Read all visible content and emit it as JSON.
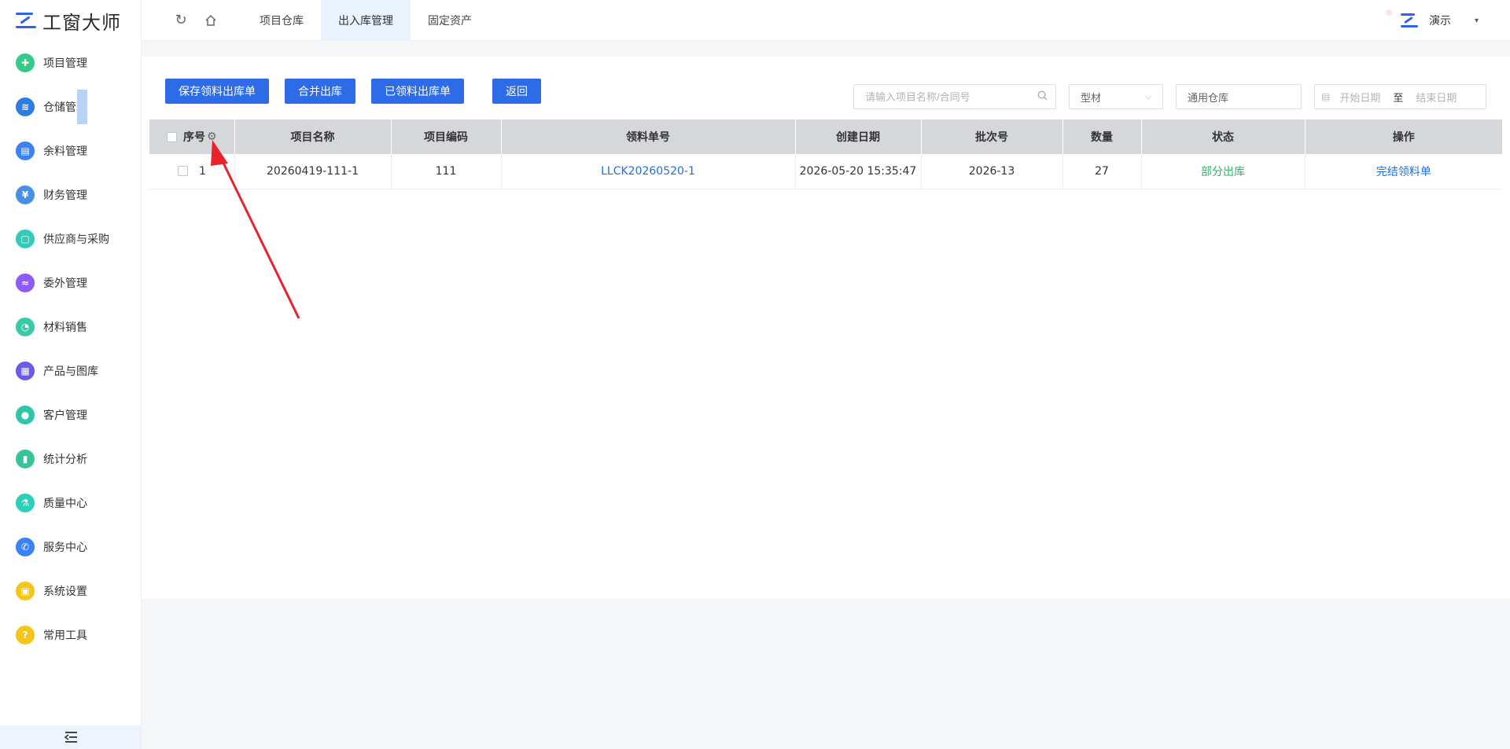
{
  "app": {
    "logo_text": "工窗大师"
  },
  "sidebar": {
    "items": [
      {
        "label": "项目管理",
        "color": "#35c98a",
        "glyph": "✚"
      },
      {
        "label": "仓储管理",
        "color": "#2f7de0",
        "glyph": "≋"
      },
      {
        "label": "余料管理",
        "color": "#3b82f6",
        "glyph": "▤"
      },
      {
        "label": "财务管理",
        "color": "#4a90e2",
        "glyph": "¥"
      },
      {
        "label": "供应商与采购",
        "color": "#35c9b7",
        "glyph": "▢"
      },
      {
        "label": "委外管理",
        "color": "#8b5cf6",
        "glyph": "≈"
      },
      {
        "label": "材料销售",
        "color": "#3cc9a8",
        "glyph": "◔"
      },
      {
        "label": "产品与图库",
        "color": "#6b5ce7",
        "glyph": "▦"
      },
      {
        "label": "客户管理",
        "color": "#2fc6a5",
        "glyph": "●"
      },
      {
        "label": "统计分析",
        "color": "#34c39a",
        "glyph": "▮"
      },
      {
        "label": "质量中心",
        "color": "#2ecfb7",
        "glyph": "⚗"
      },
      {
        "label": "服务中心",
        "color": "#3b82f6",
        "glyph": "✆"
      },
      {
        "label": "系统设置",
        "color": "#f5c518",
        "glyph": "▣"
      },
      {
        "label": "常用工具",
        "color": "#f5c518",
        "glyph": "?"
      }
    ],
    "collapse_icon": "collapse-icon"
  },
  "topbar": {
    "tabs": [
      "项目仓库",
      "出入库管理",
      "固定资产"
    ],
    "active_tab": 1,
    "user_name": "演示"
  },
  "toolbar": {
    "save_label": "保存领料出库单",
    "merge_label": "合并出库",
    "received_label": "已领料出库单",
    "back_label": "返回"
  },
  "filters": {
    "search_placeholder": "请输入项目名称/合同号",
    "type_value": "型材",
    "warehouse_value": "通用仓库",
    "start_placeholder": "开始日期",
    "date_separator": "至",
    "end_placeholder": "结束日期"
  },
  "table": {
    "headers": [
      "序号",
      "项目名称",
      "项目编码",
      "领料单号",
      "创建日期",
      "批次号",
      "数量",
      "状态",
      "操作"
    ],
    "rows": [
      {
        "seq": "1",
        "project_name": "20260419-111-1",
        "project_code": "111",
        "order_no": "LLCK20260520-1",
        "created": "2026-05-20 15:35:47",
        "batch": "2026-13",
        "qty": "27",
        "status": "部分出库",
        "action": "完结领料单"
      }
    ]
  }
}
